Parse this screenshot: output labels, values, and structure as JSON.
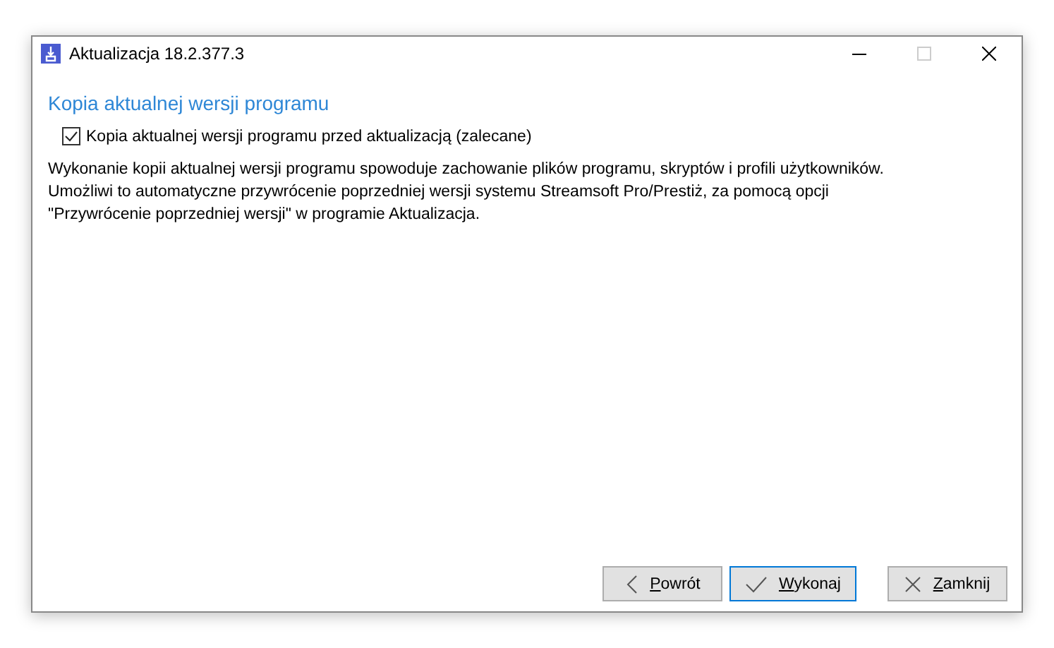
{
  "window": {
    "title": "Aktualizacja 18.2.377.3",
    "maximize_disabled": true
  },
  "heading": "Kopia aktualnej wersji programu",
  "option": {
    "label": "Kopia aktualnej wersji programu przed aktualizacją (zalecane)",
    "checked": true
  },
  "description": "Wykonanie kopii aktualnej wersji programu spowoduje zachowanie plików programu, skryptów i profili użytkowników. Umożliwi to automatyczne przywrócenie poprzedniej wersji systemu Streamsoft Pro/Prestiż, za pomocą opcji \"Przywrócenie poprzedniej wersji\" w programie Aktualizacja.",
  "buttons": [
    {
      "kind": "back",
      "label": "Powrót",
      "default": false
    },
    {
      "kind": "run",
      "label": "Wykonaj",
      "default": true
    },
    {
      "kind": "close",
      "label": "Zamknij",
      "default": false
    }
  ]
}
